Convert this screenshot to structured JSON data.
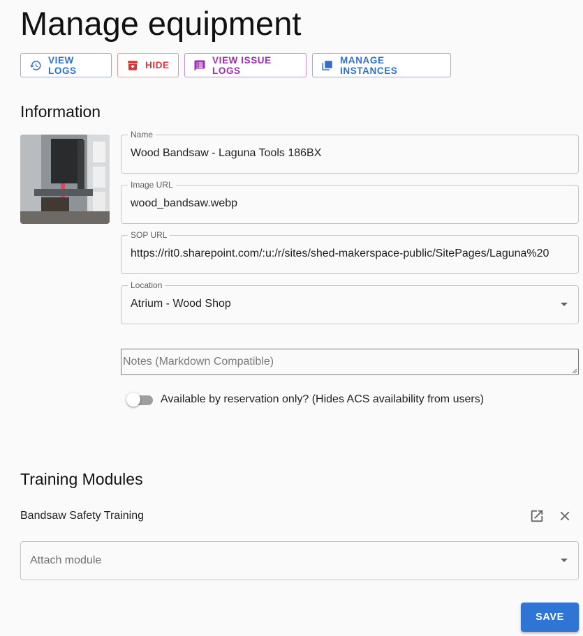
{
  "page": {
    "title": "Manage equipment"
  },
  "toolbar": {
    "view_logs": "VIEW LOGS",
    "hide": "HIDE",
    "view_issue_logs": "VIEW ISSUE LOGS",
    "manage_instances": "MANAGE INSTANCES"
  },
  "information": {
    "heading": "Information",
    "name": {
      "label": "Name",
      "value": "Wood Bandsaw - Laguna Tools 186BX"
    },
    "image_url": {
      "label": "Image URL",
      "value": "wood_bandsaw.webp"
    },
    "sop_url": {
      "label": "SOP URL",
      "value": "https://rit0.sharepoint.com/:u:/r/sites/shed-makerspace-public/SitePages/Laguna%20"
    },
    "location": {
      "label": "Location",
      "value": "Atrium - Wood Shop"
    },
    "notes": {
      "placeholder": "Notes (Markdown Compatible)"
    },
    "reservation_toggle": {
      "label": "Available by reservation only? (Hides ACS availability from users)",
      "checked": false
    }
  },
  "training": {
    "heading": "Training Modules",
    "modules": [
      {
        "name": "Bandsaw Safety Training"
      }
    ],
    "attach_placeholder": "Attach module"
  },
  "save_label": "SAVE",
  "colors": {
    "accent_blue": "#2f6fcf",
    "hide_red": "#d93737",
    "issue_purple": "#9c2eb0",
    "save_button": "#2f75d6"
  },
  "icons": [
    "history-icon",
    "archive-icon",
    "feedback-icon",
    "library-icon",
    "open-in-new-icon",
    "close-icon"
  ]
}
